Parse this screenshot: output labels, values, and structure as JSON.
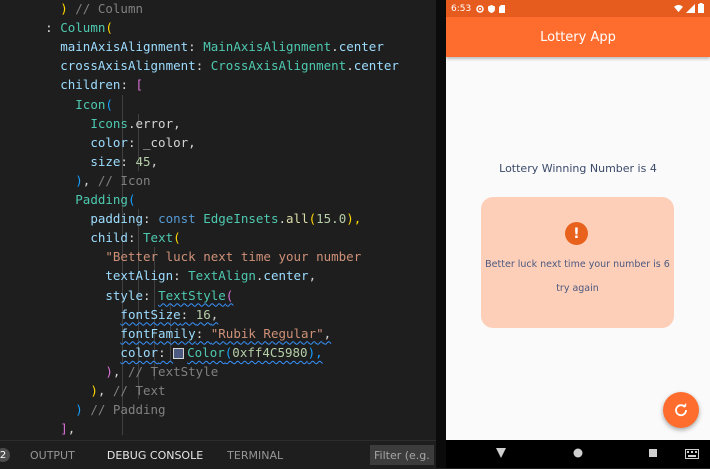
{
  "editor": {
    "lines": [
      [
        {
          "t": "        ",
          "c": "tok-punc"
        },
        {
          "t": ")",
          "c": "tok-yellow"
        },
        {
          "t": " // Column",
          "c": "tok-comment"
        }
      ],
      [
        {
          "t": "      : ",
          "c": "tok-punc"
        },
        {
          "t": "Column",
          "c": "tok-type"
        },
        {
          "t": "(",
          "c": "tok-yellow"
        }
      ],
      [
        {
          "t": "        ",
          "c": "tok-punc"
        },
        {
          "t": "mainAxisAlignment",
          "c": "tok-param"
        },
        {
          "t": ": ",
          "c": "tok-punc"
        },
        {
          "t": "MainAxisAlignment",
          "c": "tok-type"
        },
        {
          "t": ".",
          "c": "tok-punc"
        },
        {
          "t": "center",
          "c": "tok-param"
        }
      ],
      [
        {
          "t": "        ",
          "c": "tok-punc"
        },
        {
          "t": "crossAxisAlignment",
          "c": "tok-param"
        },
        {
          "t": ": ",
          "c": "tok-punc"
        },
        {
          "t": "CrossAxisAlignment",
          "c": "tok-type"
        },
        {
          "t": ".",
          "c": "tok-punc"
        },
        {
          "t": "center",
          "c": "tok-param"
        }
      ],
      [
        {
          "t": "        ",
          "c": "tok-punc"
        },
        {
          "t": "children",
          "c": "tok-param"
        },
        {
          "t": ": ",
          "c": "tok-punc"
        },
        {
          "t": "[",
          "c": "tok-pink"
        }
      ],
      [
        {
          "t": "          ",
          "c": "tok-punc"
        },
        {
          "t": "Icon",
          "c": "tok-type"
        },
        {
          "t": "(",
          "c": "tok-blue"
        }
      ],
      [
        {
          "t": "            ",
          "c": "tok-punc"
        },
        {
          "t": "Icons",
          "c": "tok-type"
        },
        {
          "t": ".error,",
          "c": "tok-punc"
        }
      ],
      [
        {
          "t": "            ",
          "c": "tok-punc"
        },
        {
          "t": "color",
          "c": "tok-param"
        },
        {
          "t": ": _color,",
          "c": "tok-punc"
        }
      ],
      [
        {
          "t": "            ",
          "c": "tok-punc"
        },
        {
          "t": "size",
          "c": "tok-param"
        },
        {
          "t": ": ",
          "c": "tok-punc"
        },
        {
          "t": "45",
          "c": "tok-num"
        },
        {
          "t": ",",
          "c": "tok-punc"
        }
      ],
      [
        {
          "t": "          ",
          "c": "tok-punc"
        },
        {
          "t": ")",
          "c": "tok-blue"
        },
        {
          "t": ", ",
          "c": "tok-punc"
        },
        {
          "t": "// Icon",
          "c": "tok-comment"
        }
      ],
      [
        {
          "t": "          ",
          "c": "tok-punc"
        },
        {
          "t": "Padding",
          "c": "tok-type"
        },
        {
          "t": "(",
          "c": "tok-blue"
        }
      ],
      [
        {
          "t": "            ",
          "c": "tok-punc"
        },
        {
          "t": "padding",
          "c": "tok-param"
        },
        {
          "t": ": ",
          "c": "tok-punc"
        },
        {
          "t": "const ",
          "c": "tok-kw"
        },
        {
          "t": "EdgeInsets",
          "c": "tok-type"
        },
        {
          "t": ".",
          "c": "tok-punc"
        },
        {
          "t": "all",
          "c": "tok-func"
        },
        {
          "t": "(",
          "c": "tok-yellow"
        },
        {
          "t": "15.0",
          "c": "tok-num"
        },
        {
          "t": "),",
          "c": "tok-yellow"
        }
      ],
      [
        {
          "t": "            ",
          "c": "tok-punc"
        },
        {
          "t": "child",
          "c": "tok-param"
        },
        {
          "t": ": ",
          "c": "tok-punc"
        },
        {
          "t": "Text",
          "c": "tok-type"
        },
        {
          "t": "(",
          "c": "tok-yellow"
        }
      ],
      [
        {
          "t": "              ",
          "c": "tok-punc"
        },
        {
          "t": "\"Better luck next time your number",
          "c": "tok-str"
        }
      ],
      [
        {
          "t": "              ",
          "c": "tok-punc"
        },
        {
          "t": "textAlign",
          "c": "tok-param"
        },
        {
          "t": ": ",
          "c": "tok-punc"
        },
        {
          "t": "TextAlign",
          "c": "tok-type"
        },
        {
          "t": ".",
          "c": "tok-punc"
        },
        {
          "t": "center",
          "c": "tok-param"
        },
        {
          "t": ",",
          "c": "tok-punc"
        }
      ],
      [
        {
          "t": "              ",
          "c": "tok-punc"
        },
        {
          "t": "style",
          "c": "tok-param"
        },
        {
          "t": ": ",
          "c": "tok-punc"
        },
        {
          "t": "TextStyle",
          "c": "tok-type squiggle"
        },
        {
          "t": "(",
          "c": "tok-pink squiggle"
        }
      ],
      [
        {
          "t": "                ",
          "c": "tok-punc"
        },
        {
          "t": "fontSize",
          "c": "tok-param squiggle"
        },
        {
          "t": ": ",
          "c": "tok-punc squiggle"
        },
        {
          "t": "16",
          "c": "tok-num squiggle"
        },
        {
          "t": ",",
          "c": "tok-punc squiggle"
        }
      ],
      [
        {
          "t": "                ",
          "c": "tok-punc"
        },
        {
          "t": "fontFamily",
          "c": "tok-param squiggle"
        },
        {
          "t": ": ",
          "c": "tok-punc squiggle"
        },
        {
          "t": "\"Rubik Regular\"",
          "c": "tok-str squiggle"
        },
        {
          "t": ",",
          "c": "tok-punc squiggle"
        }
      ],
      [
        {
          "t": "                ",
          "c": "tok-punc"
        },
        {
          "t": "color",
          "c": "tok-param squiggle"
        },
        {
          "t": ": ",
          "c": "tok-punc squiggle"
        },
        {
          "t": "__SWATCH__",
          "c": ""
        },
        {
          "t": "Color",
          "c": "tok-type squiggle"
        },
        {
          "t": "(",
          "c": "tok-blue squiggle"
        },
        {
          "t": "0xff4C5980",
          "c": "tok-num squiggle"
        },
        {
          "t": "),",
          "c": "tok-blue squiggle"
        }
      ],
      [
        {
          "t": "              ",
          "c": "tok-punc"
        },
        {
          "t": ")",
          "c": "tok-pink"
        },
        {
          "t": ", ",
          "c": "tok-punc"
        },
        {
          "t": "// TextStyle",
          "c": "tok-comment"
        }
      ],
      [
        {
          "t": "            ",
          "c": "tok-punc"
        },
        {
          "t": ")",
          "c": "tok-yellow"
        },
        {
          "t": ", ",
          "c": "tok-punc"
        },
        {
          "t": "// Text",
          "c": "tok-comment"
        }
      ],
      [
        {
          "t": "          ",
          "c": "tok-punc"
        },
        {
          "t": ")",
          "c": "tok-blue"
        },
        {
          "t": " ",
          "c": "tok-punc"
        },
        {
          "t": "// Padding",
          "c": "tok-comment"
        }
      ],
      [
        {
          "t": "        ",
          "c": "tok-punc"
        },
        {
          "t": "]",
          "c": "tok-pink"
        },
        {
          "t": ",",
          "c": "tok-punc"
        }
      ]
    ],
    "swatch_color": "#4C5980"
  },
  "panel": {
    "problems_count": "2",
    "tabs": [
      "OUTPUT",
      "DEBUG CONSOLE",
      "TERMINAL"
    ],
    "active_tab": "DEBUG CONSOLE",
    "filter_placeholder": "Filter (e.g. t"
  },
  "phone": {
    "status_time": "6:53",
    "app_title": "Lottery App",
    "winning_text": "Lottery Winning Number is 4",
    "result_message": "Better luck next time your number is 6",
    "result_number": "6",
    "try_again": "try again",
    "colors": {
      "app_bar": "#FF6D2E",
      "status_bar": "#E65C1F",
      "card": "#FDCFB8",
      "error_icon": "#E8621E",
      "text": "#4C5980"
    },
    "icons": {
      "error": "error-icon",
      "fab": "refresh-icon",
      "nav_back": "back-triangle-icon",
      "nav_home": "home-circle-icon",
      "nav_recents": "recents-square-icon"
    }
  }
}
